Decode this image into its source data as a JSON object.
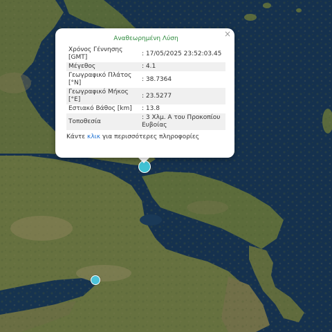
{
  "popup": {
    "title": "Αναθεωρημένη Λύση",
    "close_icon": "×",
    "rows": [
      {
        "label": "Χρόνος Γέννησης [GMT]",
        "value": ": 17/05/2025 23:52:03.45"
      },
      {
        "label": "Μέγεθος",
        "value": ": 4.1"
      },
      {
        "label": "Γεωγραφικό Πλάτος [°N]",
        "value": ": 38.7364"
      },
      {
        "label": "Γεωγραφικό Μήκος [°E]",
        "value": ": 23.5277"
      },
      {
        "label": "Εστιακό Βάθος [km]",
        "value": ": 13.8"
      },
      {
        "label": "Τοποθεσία",
        "value": ": 3 Χλμ. Α του Προκοπίου Ευβοίας"
      }
    ],
    "more_prefix": "Κάντε ",
    "more_link": "κλικ",
    "more_suffix": " για περισσότερες πληροφορίες"
  },
  "markers": [
    {
      "name": "epicenter",
      "color": "#41c2d3"
    },
    {
      "name": "second-event",
      "color": "#4cc3d8"
    }
  ],
  "colors": {
    "sea": "#14304f",
    "land": "#5a6a3d",
    "popup_title": "#2e8b3e",
    "link": "#1a6fd1"
  }
}
